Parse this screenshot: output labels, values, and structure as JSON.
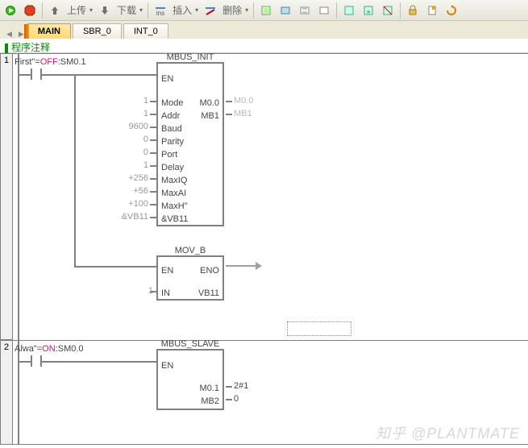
{
  "toolbar": {
    "upload": "上传",
    "download": "下载",
    "insert": "插入",
    "delete": "删除"
  },
  "tabs": {
    "main": "MAIN",
    "sbr": "SBR_0",
    "int": "INT_0"
  },
  "comment": "程序注释",
  "net1": {
    "num": "1",
    "contact_label_pre": "First\"=",
    "contact_state": "OFF",
    "contact_addr": ":SM0.1",
    "block1": {
      "title": "MBUS_INIT",
      "en": "EN",
      "rows": [
        {
          "in_val": "1",
          "in": "Mode",
          "out": "M0.0",
          "out_val": "M0.0"
        },
        {
          "in_val": "1",
          "in": "Addr",
          "out": "MB1",
          "out_val": "MB1"
        },
        {
          "in_val": "9600",
          "in": "Baud",
          "out": "",
          "out_val": ""
        },
        {
          "in_val": "0",
          "in": "Parity",
          "out": "",
          "out_val": ""
        },
        {
          "in_val": "0",
          "in": "Port",
          "out": "",
          "out_val": ""
        },
        {
          "in_val": "1",
          "in": "Delay",
          "out": "",
          "out_val": ""
        },
        {
          "in_val": "+256",
          "in": "MaxIQ",
          "out": "",
          "out_val": ""
        },
        {
          "in_val": "+56",
          "in": "MaxAI",
          "out": "",
          "out_val": ""
        },
        {
          "in_val": "+100",
          "in": "MaxH\"",
          "out": "",
          "out_val": ""
        },
        {
          "in_val": "&VB11",
          "in": "&VB11",
          "out": "",
          "out_val": ""
        }
      ]
    },
    "block2": {
      "title": "MOV_B",
      "en": "EN",
      "eno": "ENO",
      "in": "IN",
      "out": "VB11",
      "in_val": "1"
    }
  },
  "net2": {
    "num": "2",
    "contact_label_pre": "Alwa\"=",
    "contact_state": "ON",
    "contact_addr": ":SM0.0",
    "block": {
      "title": "MBUS_SLAVE",
      "en": "EN",
      "rows": [
        {
          "in": "",
          "out": "M0.1",
          "out_val": "2#1"
        },
        {
          "in": "",
          "out": "MB2",
          "out_val": "0"
        }
      ]
    }
  },
  "watermark": "知乎 @PLANTMATE"
}
